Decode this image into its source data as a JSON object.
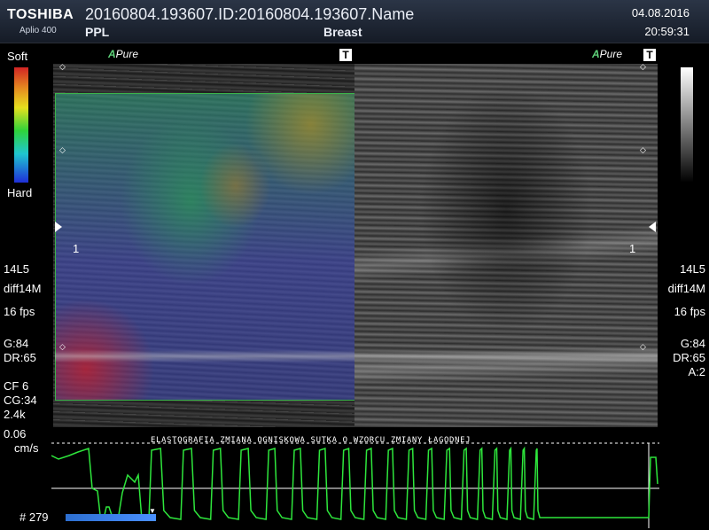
{
  "header": {
    "brand": "TOSHIBA",
    "model": "Aplio 400",
    "title": "20160804.193607.ID:20160804.193607.Name",
    "preset": "PPL",
    "organ": "Breast",
    "date": "04.08.2016",
    "time": "20:59:31"
  },
  "left_scale": {
    "top_label": "Soft",
    "bottom_label": "Hard"
  },
  "image_tags": {
    "mode": "Pure",
    "mode_prefix": "A",
    "t_label": "T"
  },
  "focus_marker": "1",
  "left_params": {
    "probe": "14L5",
    "mode": "diff14M",
    "fps": "16 fps",
    "gain": "G:84",
    "dr": "DR:65",
    "cf": "CF 6",
    "cg": "CG:34",
    "prf": "2.4k",
    "scale_value": "0.06",
    "scale_unit": "cm/s"
  },
  "right_params": {
    "probe": "14L5",
    "mode": "diff14M",
    "fps": "16 fps",
    "gain": "G:84",
    "dr": "DR:65",
    "a": "A:2"
  },
  "wave": {
    "title": "ELASTOGRAFIA ZMIANA OGNISKOWA SUTKA O WZORCU ZMIANY ŁAGODNEJ",
    "frame": "# 279"
  },
  "colors": {
    "accent_green": "#3bb34a",
    "wave_green": "#2ee63c"
  }
}
